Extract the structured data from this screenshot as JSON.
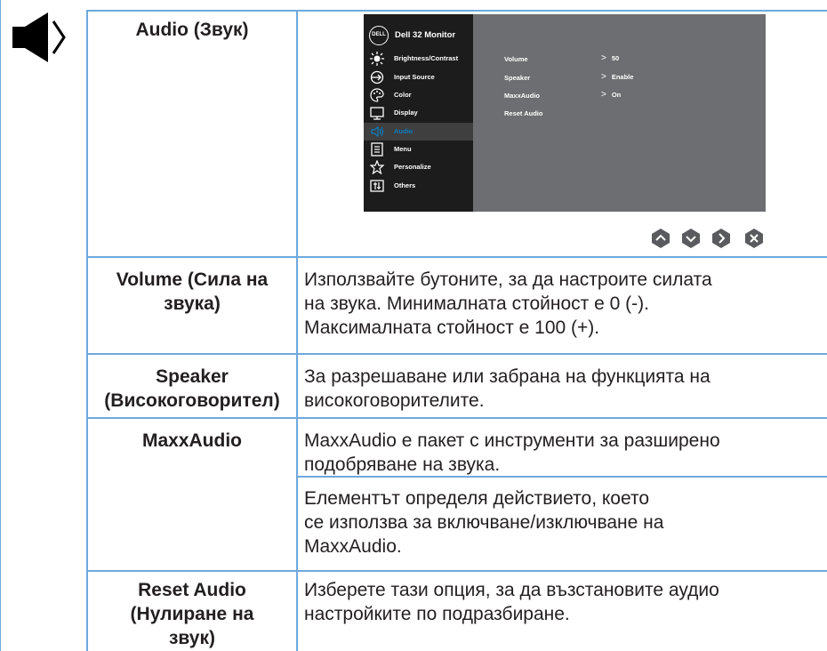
{
  "rows": {
    "audio": {
      "title": "Audio (Звук)"
    },
    "volume": {
      "title": [
        "Volume (Сила на",
        "звука)"
      ],
      "desc": [
        "Използвайте бутоните, за да настроите силата",
        "на звука. Минималната стойност е 0 (-).",
        "Максималната стойност е 100 (+)."
      ]
    },
    "speaker": {
      "title": [
        "Speaker",
        "(Високоговорител)"
      ],
      "desc": [
        "За разрешаване или забрана на функцията на",
        "високоговорителите."
      ]
    },
    "maxxaudio": {
      "title": "MaxxAudio",
      "desc1": [
        "MaxxAudio е пакет с инструменти за разширено",
        "подобряване на звука."
      ],
      "desc2": [
        "Елементът определя действието, което",
        "се използва за включване/изключване на",
        "MaxxAudio."
      ]
    },
    "reset": {
      "title": [
        "Reset Audio",
        "(Нулиране на",
        "звук)"
      ],
      "desc": [
        "Изберете тази опция, за да възстановите аудио",
        "настройките по подразбиране."
      ]
    }
  },
  "osd": {
    "logo": "DELL",
    "title": "Dell 32 Monitor",
    "menu": [
      {
        "label": "Brightness/Contrast",
        "icon": "brightness-icon"
      },
      {
        "label": "Input Source",
        "icon": "input-source-icon"
      },
      {
        "label": "Color",
        "icon": "color-icon"
      },
      {
        "label": "Display",
        "icon": "display-icon"
      },
      {
        "label": "Audio",
        "icon": "audio-icon",
        "active": true
      },
      {
        "label": "Menu",
        "icon": "menu-icon"
      },
      {
        "label": "Personalize",
        "icon": "star-icon"
      },
      {
        "label": "Others",
        "icon": "others-icon"
      }
    ],
    "settings": [
      {
        "label": "Volume",
        "value": "50"
      },
      {
        "label": "Speaker",
        "value": "Enable"
      },
      {
        "label": "MaxxAudio",
        "value": "On"
      },
      {
        "label": "Reset Audio",
        "value": ""
      }
    ],
    "nav_buttons": [
      "up-button",
      "down-button",
      "right-button",
      "close-button"
    ]
  },
  "colors": {
    "table_border": "#6fa9dc",
    "osd_bg": "#6d6e71",
    "osd_sidebar": "#1c1c1c",
    "osd_accent": "#0b7dc2"
  }
}
